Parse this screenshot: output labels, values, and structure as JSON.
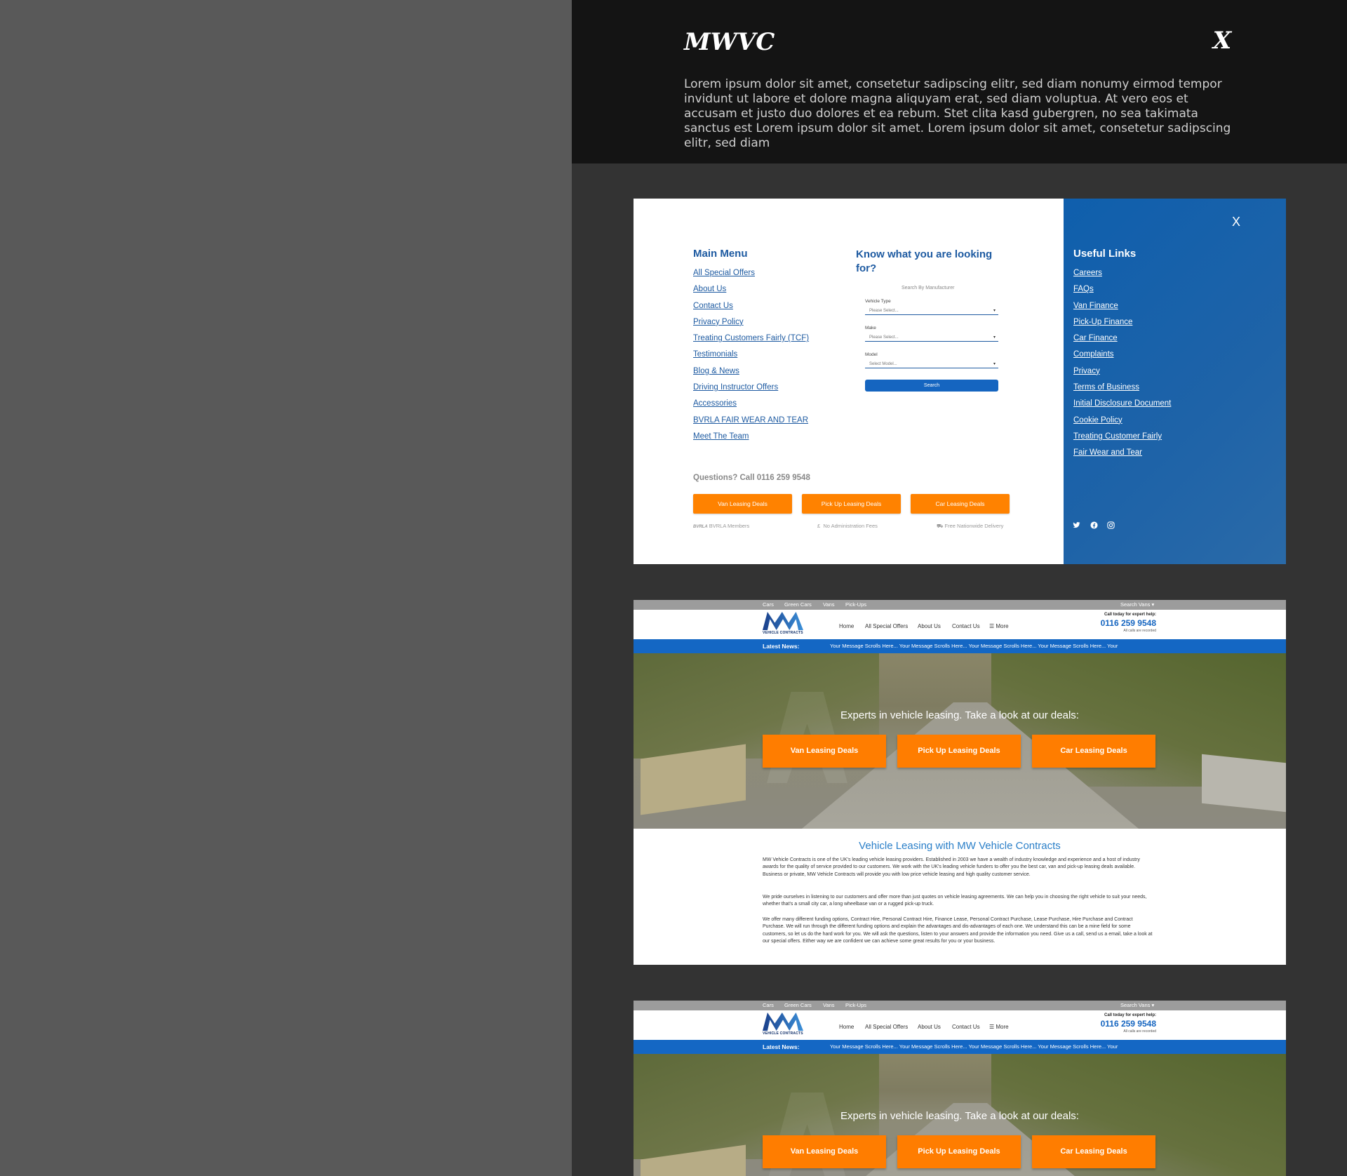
{
  "panel": {
    "title": "MWVC",
    "close_label": "X",
    "description": "Lorem ipsum dolor sit amet, consetetur sadipscing elitr, sed diam nonumy eirmod tempor invidunt ut labore et dolore magna aliquyam erat, sed diam voluptua. At vero eos et accusam et justo duo dolores et ea rebum. Stet clita kasd gubergren, no sea takimata sanctus est Lorem ipsum dolor sit amet. Lorem ipsum dolor sit amet, consetetur sadipscing elitr, sed diam"
  },
  "menu_shot": {
    "main_menu_title": "Main Menu",
    "main_menu_items": [
      "All Special Offers",
      "About Us",
      "Contact Us",
      "Privacy Policy",
      "Treating Customers Fairly (TCF)",
      "Testimonials",
      "Blog & News",
      "Driving Instructor Offers",
      "Accessories",
      "BVRLA FAIR WEAR AND TEAR",
      "Meet The Team"
    ],
    "looking_title": "Know what you are looking for?",
    "search_by": "Search By Manufacturer",
    "vehicle_type_label": "Vehicle Type",
    "vehicle_type_value": "Please Select...",
    "make_label": "Make",
    "make_value": "Please Select...",
    "model_label": "Model",
    "model_value": "Select Model...",
    "search_button": "Search",
    "questions": "Questions? Call 0116 259 9548",
    "buttons": [
      "Van Leasing Deals",
      "Pick Up Leasing Deals",
      "Car Leasing Deals"
    ],
    "features": [
      "BVRLA Members",
      "No Administration Fees",
      "Free Nationwide Delivery"
    ],
    "bvrla_logo_text": "BVRLA",
    "pound_symbol": "£",
    "useful_title": "Useful Links",
    "useful_items": [
      "Careers",
      "FAQs",
      "Van Finance",
      "Pick-Up Finance",
      "Car Finance",
      "Complaints",
      "Privacy",
      "Terms of Business",
      "Initial Disclosure Document",
      "Cookie Policy",
      "Treating Customer Fairly",
      "Fair Wear and Tear"
    ],
    "close_label": "X",
    "social_icons": [
      "twitter-icon",
      "facebook-icon",
      "instagram-icon"
    ]
  },
  "site": {
    "top_nav": [
      "Cars",
      "Green Cars",
      "Vans",
      "Pick-Ups"
    ],
    "search_vans": "Search Vans ▾",
    "logo_text": "VEHICLE CONTRACTS",
    "header_nav": [
      "Home",
      "All Special Offers",
      "About Us",
      "Contact Us",
      "☰ More"
    ],
    "call_label": "Call today for expert help:",
    "phone": "0116 259 9548",
    "calls_recorded": "All calls are recorded",
    "news_label": "Latest News:",
    "news_text": "Your Message Scrolls Here... Your Message Scrolls Here... Your Message Scrolls Here... Your Message Scrolls Here... Your",
    "hero_tagline": "Experts in vehicle leasing. Take a look at our deals:",
    "hero_buttons": [
      "Van Leasing Deals",
      "Pick Up Leasing Deals",
      "Car Leasing Deals"
    ],
    "body_title": "Vehicle Leasing with MW Vehicle Contracts",
    "body_paragraphs": [
      "MW Vehicle Contracts is one of the UK's leading vehicle leasing providers. Established in 2003 we have a wealth of industry knowledge and experience and a host of industry awards for the quality of service provided to our customers. We work with the UK's leading vehicle funders to offer you the best car, van and pick-up leasing deals available. Business or private, MW Vehicle Contracts will provide you with low price vehicle leasing and high quality customer service.",
      "We pride ourselves in listening to our customers and offer more than just quotes on vehicle leasing agreements. We can help you in choosing the right vehicle to suit your needs, whether that's a small city car, a long wheelbase van or a rugged pick-up truck.",
      "We offer many different funding options, Contract Hire, Personal Contract Hire, Finance Lease, Personal Contract Purchase, Lease Purchase, Hire Purchase and Contract Purchase. We will run through the different funding options and explain the advantages and dis-advantages of each one. We understand this can be a mine field for some customers, so let us do the hard work for you. We will ask the questions, listen to your answers and provide the information you need. Give us a call, send us a email, take a look at our special offers. Either way we are confident we can achieve some great results for you or your business."
    ]
  },
  "colors": {
    "brand_blue": "#1565c0",
    "accent_orange": "#ff8200",
    "panel_bg": "#333333",
    "header_bg": "#141414"
  }
}
